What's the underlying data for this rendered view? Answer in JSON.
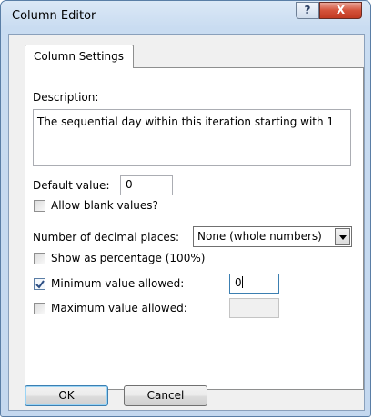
{
  "window": {
    "title": "Column Editor",
    "help_label": "?",
    "close_label": "X"
  },
  "tabs": [
    {
      "label": "Column Settings",
      "selected": true
    }
  ],
  "form": {
    "description_label": "Description:",
    "description_value": "The sequential day within this iteration starting with 1",
    "default_value_label": "Default value:",
    "default_value": "0",
    "allow_blank_label": "Allow blank values?",
    "allow_blank_checked": false,
    "decimal_places_label": "Number of decimal places:",
    "decimal_places_value": "None (whole numbers)",
    "show_percentage_label": "Show as percentage (100%)",
    "show_percentage_checked": false,
    "min_value_label": "Minimum value allowed:",
    "min_value_checked": true,
    "min_value": "0",
    "max_value_label": "Maximum value allowed:",
    "max_value_checked": false,
    "max_value": ""
  },
  "buttons": {
    "ok_label": "OK",
    "cancel_label": "Cancel"
  },
  "colors": {
    "frame": "#c4d8ef",
    "close_button": "#c13a22",
    "focus_border": "#3c7fb1"
  }
}
